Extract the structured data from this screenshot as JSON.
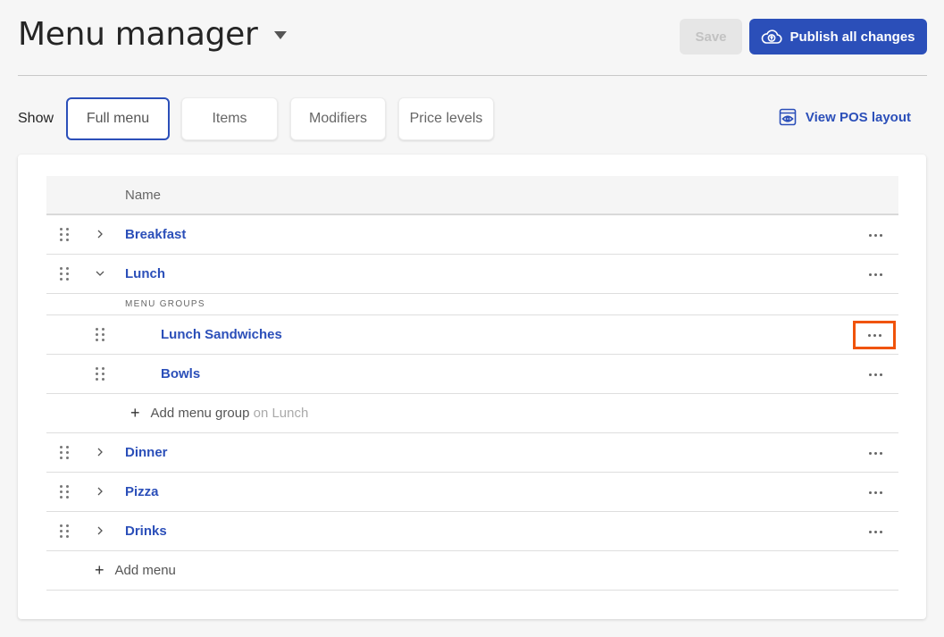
{
  "header": {
    "title": "Menu manager",
    "save_label": "Save",
    "publish_label": "Publish all changes"
  },
  "filters": {
    "show_label": "Show",
    "options": [
      {
        "label": "Full menu",
        "active": true
      },
      {
        "label": "Items",
        "active": false
      },
      {
        "label": "Modifiers",
        "active": false
      },
      {
        "label": "Price levels",
        "active": false
      }
    ],
    "view_pos_label": "View POS layout"
  },
  "table": {
    "column_name": "Name",
    "menus": [
      {
        "name": "Breakfast",
        "expanded": false
      },
      {
        "name": "Lunch",
        "expanded": true
      },
      {
        "name": "Dinner",
        "expanded": false
      },
      {
        "name": "Pizza",
        "expanded": false
      },
      {
        "name": "Drinks",
        "expanded": false
      }
    ],
    "lunch_groups_label": "MENU GROUPS",
    "lunch_groups": [
      {
        "name": "Lunch Sandwiches",
        "highlighted": true
      },
      {
        "name": "Bowls",
        "highlighted": false
      }
    ],
    "add_group_label": "Add menu group",
    "add_group_suffix": "on Lunch",
    "add_menu_label": "Add menu"
  },
  "colors": {
    "accent": "#2b4fb9",
    "highlight": "#f0530a"
  }
}
